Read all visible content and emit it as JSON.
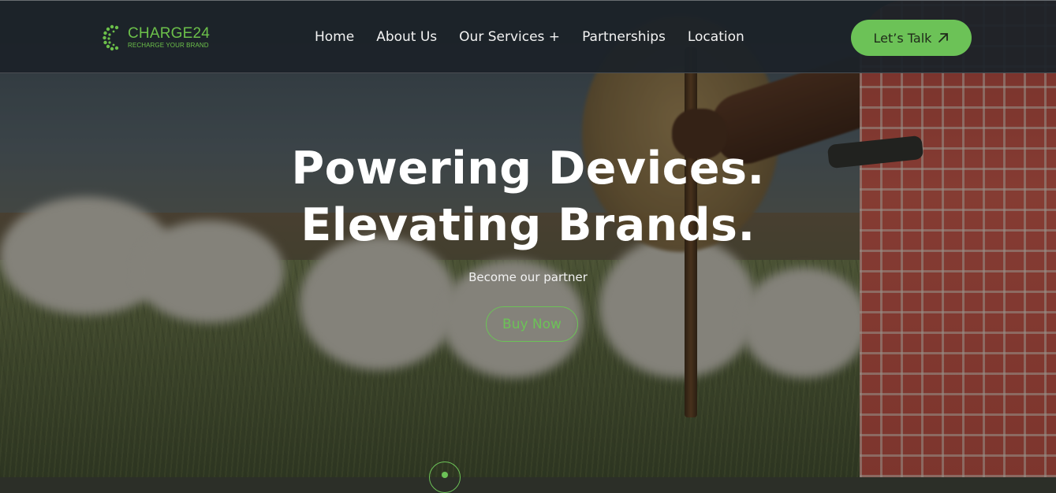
{
  "brand": {
    "name": "CHARGE24",
    "tagline": "RECHARGE YOUR BRAND",
    "accent_color": "#6cc257"
  },
  "nav": {
    "items": [
      {
        "label": "Home"
      },
      {
        "label": "About Us"
      },
      {
        "label": "Our Services +"
      },
      {
        "label": "Partnerships"
      },
      {
        "label": "Location"
      }
    ]
  },
  "header": {
    "cta_label": "Let’s Talk",
    "cta_icon": "arrow-up-right-icon"
  },
  "hero": {
    "title_line1": "Powering Devices.",
    "title_line2": "Elevating Brands.",
    "subtitle": "Become our partner",
    "button_label": "Buy Now",
    "scroll_icon": "scroll-down-icon"
  }
}
